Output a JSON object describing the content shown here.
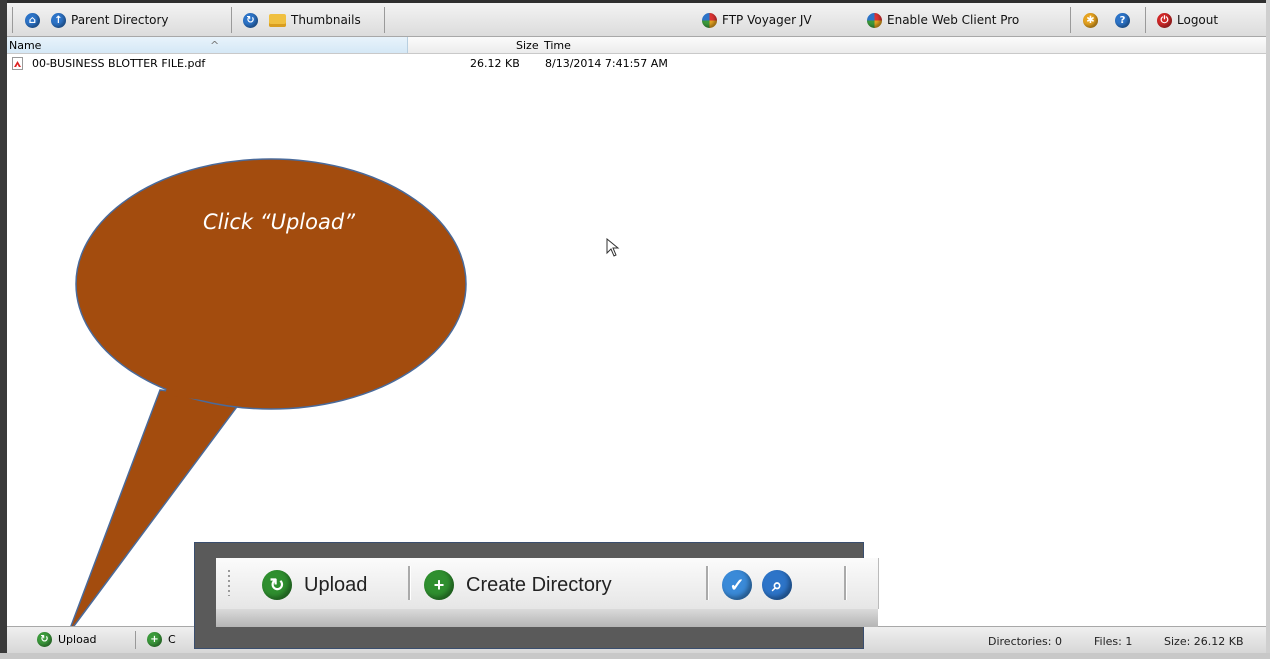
{
  "toolbar": {
    "parent_directory_label": "Parent Directory",
    "thumbnails_label": "Thumbnails",
    "ftp_voyager_label": "FTP Voyager JV",
    "enable_web_client_pro_label": "Enable Web Client Pro",
    "logout_label": "Logout"
  },
  "columns": {
    "name": "Name",
    "size": "Size",
    "time": "Time"
  },
  "files": [
    {
      "name": "00-BUSINESS BLOTTER FILE.pdf",
      "size": "26.12 KB",
      "time": "8/13/2014 7:41:57 AM"
    }
  ],
  "callout": {
    "text": "Click “Upload”",
    "color": "#a34c0e"
  },
  "zoom_toolbar": {
    "upload_label": "Upload",
    "create_directory_label": "Create Directory"
  },
  "statusbar": {
    "upload_label": "Upload",
    "create_partial_label": "C",
    "directories": "Directories: 0",
    "files": "Files: 1",
    "size": "Size: 26.12 KB"
  }
}
